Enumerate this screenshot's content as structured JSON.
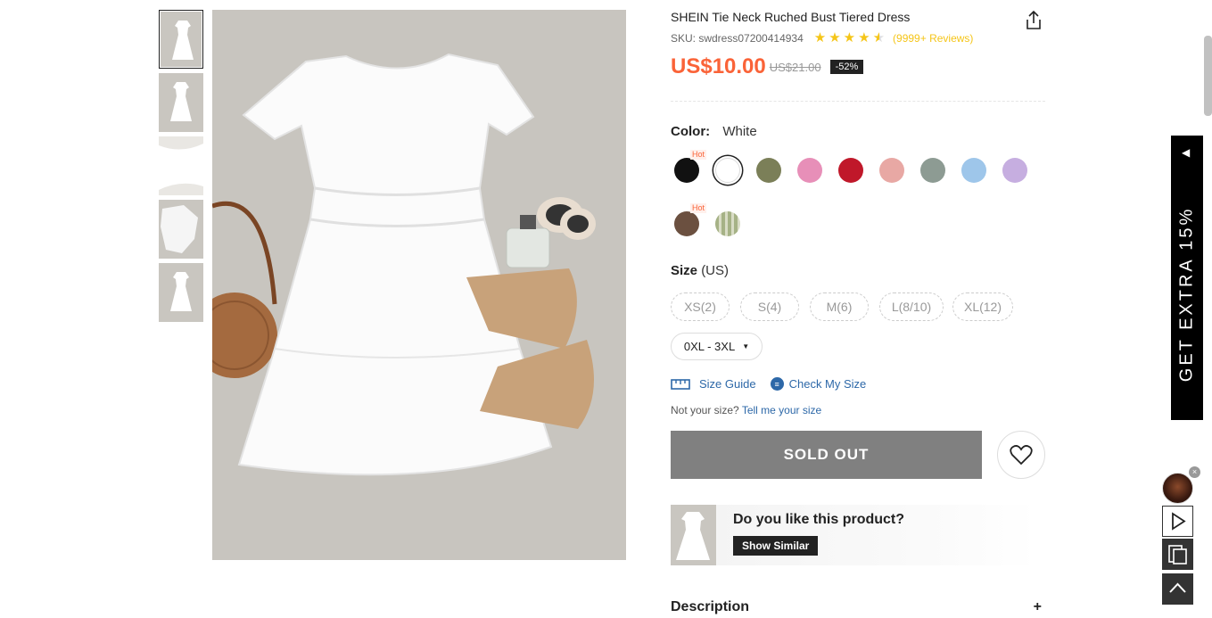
{
  "product": {
    "title": "SHEIN Tie Neck Ruched Bust Tiered Dress",
    "sku": "SKU: swdress07200414934",
    "rating_stars": 4.5,
    "reviews": "(9999+ Reviews)",
    "price": "US$10.00",
    "original_price": "US$21.00",
    "discount": "-52%"
  },
  "color": {
    "label": "Color:",
    "selected": "White",
    "hot_tag": "Hot",
    "swatches": [
      {
        "name": "black",
        "hex": "#111111",
        "hot": true
      },
      {
        "name": "white",
        "hex": "#ffffff",
        "selected": true
      },
      {
        "name": "olive",
        "hex": "#7b7f58"
      },
      {
        "name": "pink",
        "hex": "#e78fb8"
      },
      {
        "name": "red",
        "hex": "#c0182a"
      },
      {
        "name": "light-pink",
        "hex": "#e8a8a4"
      },
      {
        "name": "sage-gray",
        "hex": "#8d9b93"
      },
      {
        "name": "light-blue",
        "hex": "#9ec6ea"
      },
      {
        "name": "lilac",
        "hex": "#c6aee0"
      },
      {
        "name": "brown",
        "hex": "#6b5040",
        "hot": true
      },
      {
        "name": "green-stripe",
        "hex": "#a6b286"
      }
    ]
  },
  "size": {
    "label": "Size",
    "unit": "(US)",
    "options": [
      "XS(2)",
      "S(4)",
      "M(6)",
      "L(8/10)",
      "XL(12)"
    ],
    "plus_select": "0XL - 3XL",
    "size_guide": "Size Guide",
    "check_my_size": "Check My Size",
    "not_your_size": "Not your size?",
    "tell_me": "Tell me your size"
  },
  "actions": {
    "sold_out": "SOLD OUT"
  },
  "like": {
    "question": "Do you like this product?",
    "show_similar": "Show Similar"
  },
  "description": {
    "label": "Description",
    "toggle": "+"
  },
  "promo": {
    "text": "GET EXTRA 15%"
  }
}
